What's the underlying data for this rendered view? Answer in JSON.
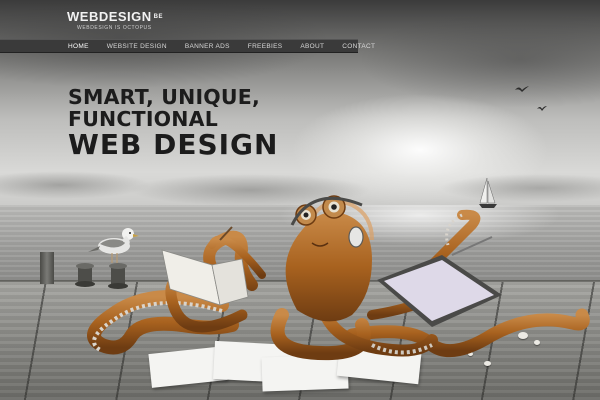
{
  "site": {
    "logo_text": "WEBDESIGN",
    "logo_suffix": "BE",
    "tagline": "WEBDESIGN  IS  OCTOPUS"
  },
  "nav": {
    "items": [
      {
        "label": "HOME",
        "active": true
      },
      {
        "label": "WEBSITE DESIGN",
        "active": false
      },
      {
        "label": "BANNER ADS",
        "active": false
      },
      {
        "label": "FREEBIES",
        "active": false
      },
      {
        "label": "ABOUT",
        "active": false
      },
      {
        "label": "CONTACT",
        "active": false
      }
    ]
  },
  "hero": {
    "line1": "SMART, UNIQUE,",
    "line2": "FUNCTIONAL",
    "line3": "WEB DESIGN"
  },
  "colors": {
    "nav_bg": "#3a3a3a",
    "headline": "#1c1c1c",
    "octopus": "#b06a2a",
    "tentacle_underside": "#d9d4cc"
  },
  "icons": {
    "bird": "flying-seagull-icon",
    "boat": "sailboat-icon",
    "seagull": "seagull-icon"
  }
}
